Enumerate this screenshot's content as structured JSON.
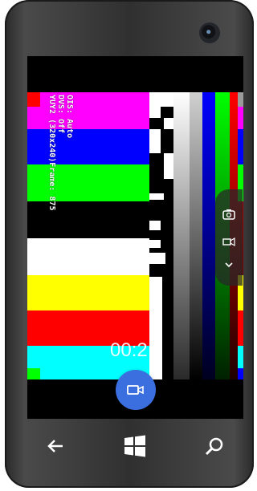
{
  "overlay": {
    "line1": "OIS: Auto",
    "line2": "DVS: Off",
    "line3": "YUY2 (320x240)Frame: 875"
  },
  "recording": {
    "timer": "00:2",
    "record_icon": "video-camera-icon"
  },
  "side_panel": {
    "icons": [
      "camera-switch-icon",
      "video-settings-icon",
      "chevron-down-icon"
    ]
  },
  "navigation": {
    "icons": [
      "back-arrow-icon",
      "windows-start-icon",
      "search-icon"
    ]
  },
  "colors": {
    "magenta": "#ff00ff",
    "blue": "#0000ff",
    "green": "#00ff00",
    "black": "#000000",
    "white": "#ffffff",
    "yellow": "#ffff00",
    "red": "#ff0000",
    "cyan": "#00ffff",
    "record_button": "#3b6fe0"
  }
}
